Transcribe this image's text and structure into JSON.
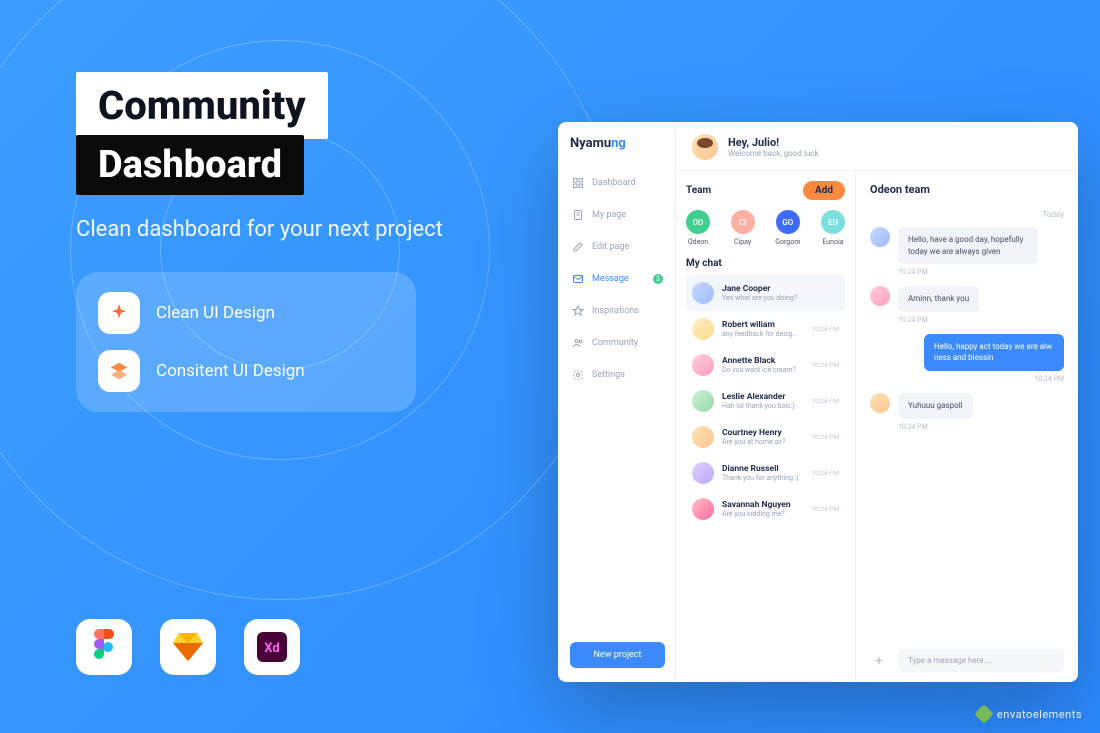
{
  "promo": {
    "title": "Community",
    "subtitle": "Dashboard",
    "tagline": "Clean dashboard for your next project",
    "features": [
      "Clean UI Design",
      "Consitent UI Design"
    ]
  },
  "tools": [
    "figma",
    "sketch",
    "xd"
  ],
  "watermark": "envatoelements",
  "app": {
    "brand": {
      "part1": "Nyamu",
      "part2": "ng"
    },
    "nav": [
      {
        "label": "Dashboard",
        "icon": "grid"
      },
      {
        "label": "My page",
        "icon": "page"
      },
      {
        "label": "Edit page",
        "icon": "edit"
      },
      {
        "label": "Message",
        "icon": "mail",
        "active": true,
        "badge": "3"
      },
      {
        "label": "Inspirations",
        "icon": "star"
      },
      {
        "label": "Community",
        "icon": "people"
      },
      {
        "label": "Settings",
        "icon": "gear"
      }
    ],
    "new_project_label": "New project",
    "header": {
      "greeting": "Hey, Julio!",
      "sub": "Welcome back, good luck"
    },
    "team": {
      "title": "Team",
      "add_label": "Add",
      "members": [
        {
          "initials": "OD",
          "name": "Odeon",
          "color": "c-green"
        },
        {
          "initials": "CI",
          "name": "Cipay",
          "color": "c-pink"
        },
        {
          "initials": "GO",
          "name": "Gorgom",
          "color": "c-blue"
        },
        {
          "initials": "EU",
          "name": "Eunoia",
          "color": "c-teal"
        }
      ]
    },
    "mychat_label": "My chat",
    "chats": [
      {
        "name": "Jane Cooper",
        "preview": "Yes what are you doing?",
        "time": "",
        "selected": true,
        "av": "av1"
      },
      {
        "name": "Robert wiliam",
        "preview": "any feedback for design?",
        "time": "10:24 PM",
        "av": "av2"
      },
      {
        "name": "Annette Black",
        "preview": "Do you want ice cream?",
        "time": "10:24 PM",
        "av": "av3"
      },
      {
        "name": "Leslie Alexander",
        "preview": "Hah lol thank you bals:)",
        "time": "10:24 PM",
        "av": "av4"
      },
      {
        "name": "Courtney Henry",
        "preview": "Are you at home sir?",
        "time": "10:24 PM",
        "av": "av5"
      },
      {
        "name": "Dianne Russell",
        "preview": "Thank you for anything :(",
        "time": "10:24 PM",
        "av": "av6"
      },
      {
        "name": "Savannah Nguyen",
        "preview": "Are you kidding me?",
        "time": "10:24 PM",
        "av": "av7"
      }
    ],
    "conversation": {
      "title": "Odeon team",
      "date": "Today",
      "messages": [
        {
          "side": "left",
          "text": "Hello, have a good day, hopefully today we are always given",
          "time": "10:24 PM",
          "av": "av1"
        },
        {
          "side": "left",
          "text": "Aminn, thank you",
          "time": "10:24 PM",
          "av": "av3"
        },
        {
          "side": "right",
          "text": "Hello, happy act today we are alw ness and blessin",
          "time": "10:24 PM"
        },
        {
          "side": "left",
          "text": "Yuhuuu gaspoll",
          "time": "10:24 PM",
          "av": "av5"
        }
      ],
      "composer_placeholder": "Type a message here...."
    }
  }
}
